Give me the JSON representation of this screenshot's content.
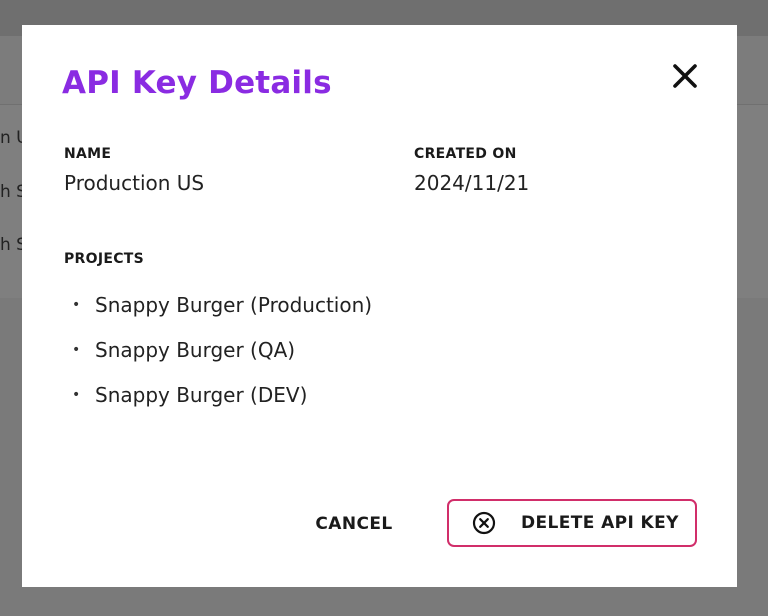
{
  "modal": {
    "title": "API Key Details",
    "name_label": "NAME",
    "name_value": "Production US",
    "created_label": "CREATED ON",
    "created_value": "2024/11/21",
    "projects_label": "PROJECTS",
    "projects": [
      "Snappy Burger (Production)",
      "Snappy Burger (QA)",
      "Snappy Burger (DEV)"
    ],
    "cancel_label": "CANCEL",
    "delete_label": "DELETE API KEY",
    "close_icon": "close-icon",
    "delete_icon": "circle-x-icon"
  },
  "background": {
    "row_fragments": [
      "n U",
      "h S",
      "h S"
    ]
  },
  "colors": {
    "title": "#8a2be2",
    "delete_border": "#d12e6a",
    "overlay": "#7a7a7a"
  }
}
